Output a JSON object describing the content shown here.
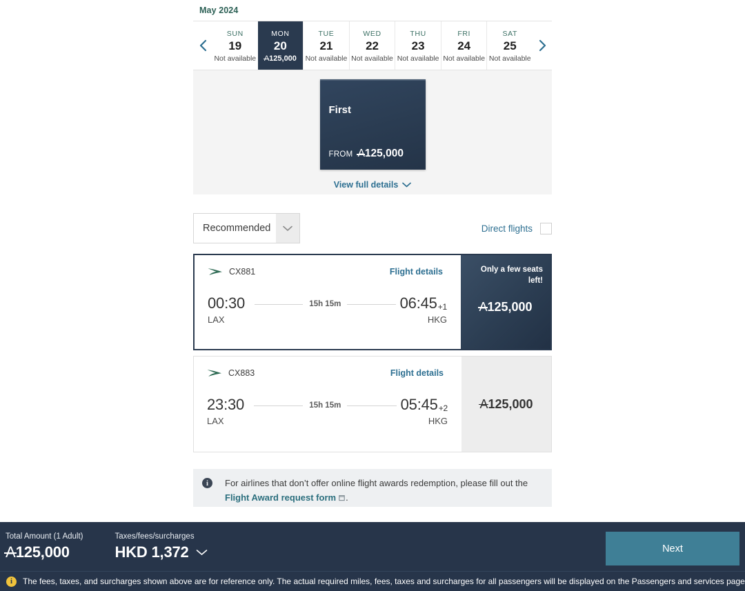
{
  "calendar": {
    "month_label": "May 2024",
    "prev_arrow_icon": "chevron-left-icon",
    "next_arrow_icon": "chevron-right-icon",
    "days": [
      {
        "dow": "SUN",
        "date": "19",
        "status": "Not available",
        "selected": false
      },
      {
        "dow": "MON",
        "date": "20",
        "status": "125,000",
        "selected": true
      },
      {
        "dow": "TUE",
        "date": "21",
        "status": "Not available",
        "selected": false
      },
      {
        "dow": "WED",
        "date": "22",
        "status": "Not available",
        "selected": false
      },
      {
        "dow": "THU",
        "date": "23",
        "status": "Not available",
        "selected": false
      },
      {
        "dow": "FRI",
        "date": "24",
        "status": "Not available",
        "selected": false
      },
      {
        "dow": "SAT",
        "date": "25",
        "status": "Not available",
        "selected": false
      }
    ]
  },
  "cabin": {
    "name": "First",
    "from_label": "FROM",
    "price": "125,000",
    "view_details_label": "View full details",
    "view_details_icon": "chevron-down-icon"
  },
  "filters": {
    "sort_value": "Recommended",
    "sort_icon": "chevron-down-icon",
    "direct_flights_label": "Direct flights",
    "direct_flights_checked": false
  },
  "flights": [
    {
      "airline_icon": "cathay-brushwing-icon",
      "flight_number": "CX881",
      "details_link": "Flight details",
      "depart_time": "00:30",
      "depart_airport": "LAX",
      "duration": "15h 15m",
      "arrive_time": "06:45",
      "arrive_day_offset": "+1",
      "arrive_airport": "HKG",
      "seats_note": "Only a few seats left!",
      "price": "125,000",
      "selected": true
    },
    {
      "airline_icon": "cathay-brushwing-icon",
      "flight_number": "CX883",
      "details_link": "Flight details",
      "depart_time": "23:30",
      "depart_airport": "LAX",
      "duration": "15h 15m",
      "arrive_time": "05:45",
      "arrive_day_offset": "+2",
      "arrive_airport": "HKG",
      "seats_note": "",
      "price": "125,000",
      "selected": false
    }
  ],
  "notice": {
    "icon": "info-icon",
    "text_before": "For airlines that don’t offer online flight awards redemption, please fill out the",
    "link_text": "Flight Award request form",
    "link_icon": "external-link-icon",
    "text_after": "."
  },
  "footer": {
    "total_label": "Total Amount (1 Adult)",
    "total_value": "125,000",
    "taxes_label": "Taxes/fees/surcharges",
    "taxes_value": "HKD 1,372",
    "taxes_icon": "chevron-down-icon",
    "next_label": "Next",
    "disclaimer_icon": "warning-info-icon",
    "disclaimer": "The fees, taxes, and surcharges shown above are for reference only. The actual required miles, fees, taxes and surcharges for all passengers will be displayed on the Passengers and services page."
  },
  "colors": {
    "brand_navy": "#27354a",
    "accent_teal": "#3f7f96",
    "link_blue": "#2d6f91",
    "month_green": "#2c6055",
    "warning_amber": "#f0c33c",
    "cathay_green": "#2e6b54"
  }
}
